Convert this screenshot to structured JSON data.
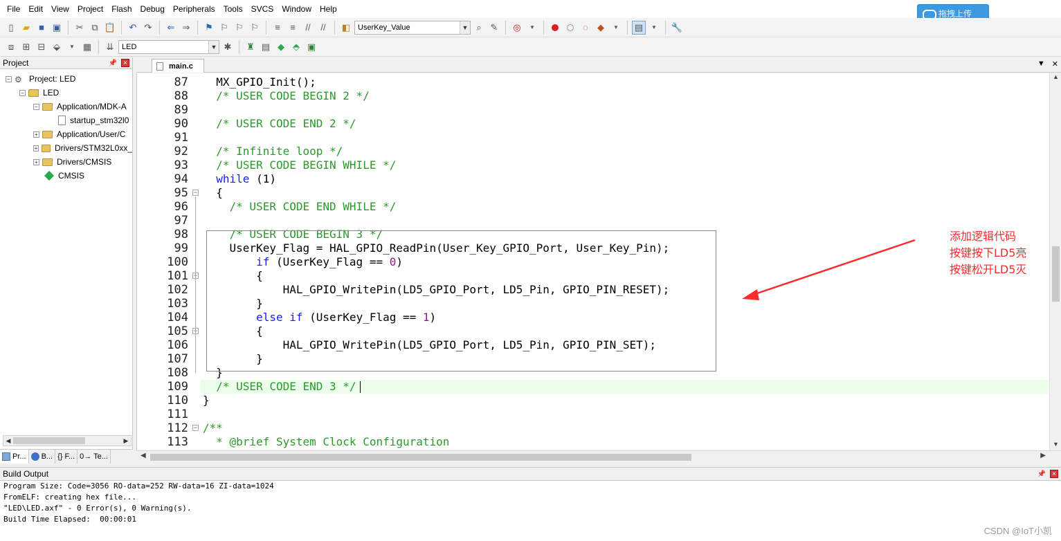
{
  "menu": [
    "File",
    "Edit",
    "View",
    "Project",
    "Flash",
    "Debug",
    "Peripherals",
    "Tools",
    "SVCS",
    "Window",
    "Help"
  ],
  "upload_button": "拖拽上传",
  "toolbar": {
    "find_combo": "UserKey_Value",
    "target_combo": "LED"
  },
  "project": {
    "header": "Project",
    "tree": [
      {
        "label": "Project: LED"
      },
      {
        "label": "LED"
      },
      {
        "label": "Application/MDK-A"
      },
      {
        "label": "startup_stm32l0"
      },
      {
        "label": "Application/User/C"
      },
      {
        "label": "Drivers/STM32L0xx_"
      },
      {
        "label": "Drivers/CMSIS"
      },
      {
        "label": "CMSIS"
      }
    ],
    "tabs": [
      "Pr...",
      "B...",
      "{} F...",
      "0→ Te..."
    ]
  },
  "editor": {
    "tab": "main.c",
    "lines": [
      {
        "n": "87",
        "code": "  MX_GPIO_Init();",
        "cls": ""
      },
      {
        "n": "88",
        "code": "  /* USER CODE BEGIN 2 */",
        "cls": "cm"
      },
      {
        "n": "89",
        "code": "",
        "cls": ""
      },
      {
        "n": "90",
        "code": "  /* USER CODE END 2 */",
        "cls": "cm"
      },
      {
        "n": "91",
        "code": "",
        "cls": ""
      },
      {
        "n": "92",
        "code": "  /* Infinite loop */",
        "cls": "cm"
      },
      {
        "n": "93",
        "code": "  /* USER CODE BEGIN WHILE */",
        "cls": "cm"
      },
      {
        "n": "94",
        "code": "  while (1)",
        "cls": ""
      },
      {
        "n": "95",
        "code": "  {",
        "cls": ""
      },
      {
        "n": "96",
        "code": "    /* USER CODE END WHILE */",
        "cls": "cm"
      },
      {
        "n": "97",
        "code": "",
        "cls": ""
      },
      {
        "n": "98",
        "code": "    /* USER CODE BEGIN 3 */",
        "cls": "cm"
      },
      {
        "n": "99",
        "code": "    UserKey_Flag = HAL_GPIO_ReadPin(User_Key_GPIO_Port, User_Key_Pin);",
        "cls": ""
      },
      {
        "n": "100",
        "code": "        if (UserKey_Flag == 0)",
        "cls": ""
      },
      {
        "n": "101",
        "code": "        {",
        "cls": ""
      },
      {
        "n": "102",
        "code": "            HAL_GPIO_WritePin(LD5_GPIO_Port, LD5_Pin, GPIO_PIN_RESET);",
        "cls": ""
      },
      {
        "n": "103",
        "code": "        }",
        "cls": ""
      },
      {
        "n": "104",
        "code": "        else if (UserKey_Flag == 1)",
        "cls": ""
      },
      {
        "n": "105",
        "code": "        {",
        "cls": ""
      },
      {
        "n": "106",
        "code": "            HAL_GPIO_WritePin(LD5_GPIO_Port, LD5_Pin, GPIO_PIN_SET);",
        "cls": ""
      },
      {
        "n": "107",
        "code": "        }",
        "cls": ""
      },
      {
        "n": "108",
        "code": "  }",
        "cls": ""
      },
      {
        "n": "109",
        "code": "  /* USER CODE END 3 */",
        "cls": "cm"
      },
      {
        "n": "110",
        "code": "}",
        "cls": ""
      },
      {
        "n": "111",
        "code": "",
        "cls": ""
      },
      {
        "n": "112",
        "code": "/**",
        "cls": "cm"
      },
      {
        "n": "113",
        "code": "  * @brief System Clock Configuration",
        "cls": "cm"
      }
    ]
  },
  "annotation": [
    "添加逻辑代码",
    "按键按下LD5亮",
    "按键松开LD5灭"
  ],
  "build": {
    "header": "Build Output",
    "lines": [
      "Program Size: Code=3056 RO-data=252 RW-data=16 ZI-data=1024",
      "FromELF: creating hex file...",
      "\"LED\\LED.axf\" - 0 Error(s), 0 Warning(s).",
      "Build Time Elapsed:  00:00:01"
    ]
  },
  "watermark": "CSDN @IoT小凯",
  "colors": {
    "comment": "#2b9a2b",
    "keyword": "#1a1aff",
    "annotation": "#ff2a2a",
    "current_line": "#ecfdec"
  }
}
